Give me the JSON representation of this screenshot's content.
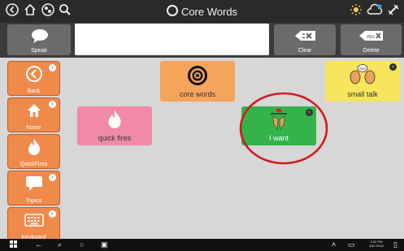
{
  "topbar": {
    "title": "Core Words",
    "left_icons": [
      "back-icon",
      "home-icon",
      "globe-icon",
      "search-icon"
    ],
    "right_icons": [
      "brightness-icon",
      "cloud-icon",
      "settings-icon"
    ]
  },
  "message_bar": {
    "speak_label": "Speak",
    "clear_label": "Clear",
    "delete_label": "Delete"
  },
  "sidebar": [
    {
      "label": "Back",
      "icon": "back-arrow-icon"
    },
    {
      "label": "home",
      "icon": "home-icon"
    },
    {
      "label": "QuickFires",
      "icon": "fire-icon"
    },
    {
      "label": "Topics",
      "icon": "speech-bubble-icon"
    },
    {
      "label": "Keyboard",
      "icon": "keyboard-icon"
    }
  ],
  "tiles": [
    {
      "label": "core words",
      "color": "#f6a35c",
      "icon": "target-icon"
    },
    {
      "label": "small talk",
      "color": "#f7e55d",
      "icon": "faces-icon"
    },
    {
      "label": "quick fires",
      "color": "#f08aa6",
      "icon": "fire-icon"
    },
    {
      "label": "I want",
      "color": "#33b34a",
      "icon": "hands-icon"
    }
  ],
  "taskbar": {
    "time": "3:32 PM",
    "date": "4/11/2018"
  },
  "colors": {
    "highlight_circle": "#d11c1c"
  }
}
